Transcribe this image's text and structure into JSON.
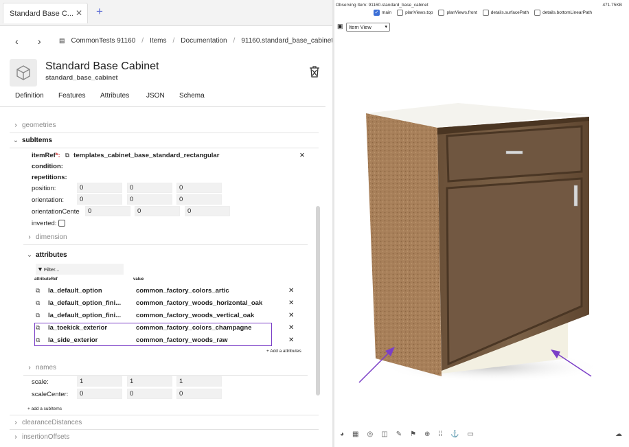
{
  "tab": {
    "title": "Standard Base C...",
    "close": "✕",
    "new": "+"
  },
  "breadcrumb": {
    "project": "CommonTests 91160",
    "items": "Items",
    "docs": "Documentation",
    "current": "91160.standard_base_cabinet"
  },
  "header": {
    "title": "Standard Base Cabinet",
    "subtitle": "standard_base_cabinet"
  },
  "tabs": [
    "Definition",
    "Features",
    "Attributes",
    "JSON",
    "Schema"
  ],
  "sections": {
    "geometries": "geometries",
    "subItems": "subItems",
    "dimension": "dimension",
    "attributes": "attributes",
    "names": "names",
    "clearance": "clearanceDistances",
    "insertion": "insertionOffsets"
  },
  "subitem": {
    "itemRef_label": "itemRef",
    "itemRef_req": "*:",
    "itemRef_value": "templates_cabinet_base_standard_rectangular",
    "condition": "condition:",
    "repetitions": "repetitions:",
    "position_label": "position:",
    "position": [
      "0",
      "0",
      "0"
    ],
    "orientation_label": "orientation:",
    "orientation": [
      "0",
      "0",
      "0"
    ],
    "orientationCenter_label": "orientationCente",
    "orientationCenter": [
      "0",
      "0",
      "0"
    ],
    "inverted": "inverted:",
    "scale_label": "scale:",
    "scale": [
      "1",
      "1",
      "1"
    ],
    "scaleCenter_label": "scaleCenter:",
    "scaleCenter": [
      "0",
      "0",
      "0"
    ]
  },
  "attributes": {
    "filter_placeholder": "Filter...",
    "col_ref": "attributeRef",
    "col_value": "value",
    "rows": [
      {
        "ref": "la_default_option",
        "value": "common_factory_colors_artic"
      },
      {
        "ref": "la_default_option_fini...",
        "value": "common_factory_woods_horizontal_oak"
      },
      {
        "ref": "la_default_option_fini...",
        "value": "common_factory_woods_vertical_oak"
      },
      {
        "ref": "la_toekick_exterior",
        "value": "common_factory_colors_champagne"
      },
      {
        "ref": "la_side_exterior",
        "value": "common_factory_woods_raw"
      }
    ],
    "add": "+ Add a attributes"
  },
  "add_subitems": "+ add a subItems",
  "viewer": {
    "observing": "Observing Item: 91160.standard_base_cabinet",
    "size": "471.75KB",
    "checks": [
      {
        "label": "main",
        "checked": true
      },
      {
        "label": "planViews.top",
        "checked": false
      },
      {
        "label": "planViews.front",
        "checked": false
      },
      {
        "label": "details.surfacePath",
        "checked": false
      },
      {
        "label": "details.bottomLinearPath",
        "checked": false
      }
    ],
    "view_select": "Item View"
  }
}
